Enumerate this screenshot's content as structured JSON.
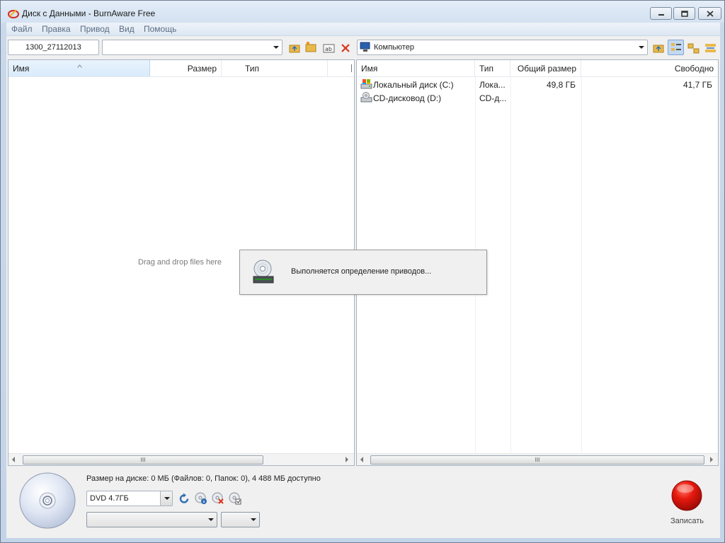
{
  "window": {
    "title": "Диск с Данными - BurnAware Free"
  },
  "menu": [
    "Файл",
    "Правка",
    "Привод",
    "Вид",
    "Помощь"
  ],
  "toolbar": {
    "disc_label": "1300_27112013",
    "path_value": "",
    "location_value": "Компьютер"
  },
  "left_pane": {
    "columns": [
      "Имя",
      "Размер",
      "Тип"
    ],
    "empty_hint": "Drag and drop files here"
  },
  "right_pane": {
    "columns": [
      "Имя",
      "Тип",
      "Общий размер",
      "Свободно"
    ],
    "rows": [
      {
        "name": "Локальный диск (C:)",
        "type": "Лока...",
        "total": "49,8 ГБ",
        "free": "41,7 ГБ",
        "icon": "hard-drive-icon"
      },
      {
        "name": "CD-дисковод (D:)",
        "type": "CD-д...",
        "total": "",
        "free": "",
        "icon": "cd-drive-icon"
      }
    ]
  },
  "dialog": {
    "message": "Выполняется определение приводов..."
  },
  "bottom": {
    "disc_status": "Размер на диске: 0 МБ (Файлов: 0, Папок: 0), 4 488 МБ доступно",
    "disc_type": "DVD 4.7ГБ",
    "drive_select": "",
    "speed_select": "",
    "burn_label": "Записать"
  },
  "scroll_thumb_glyph": "III",
  "colors": {
    "burn_button": "#e01010",
    "title_bar": "#dce7f4",
    "accent_blue": "#2e6db4"
  }
}
